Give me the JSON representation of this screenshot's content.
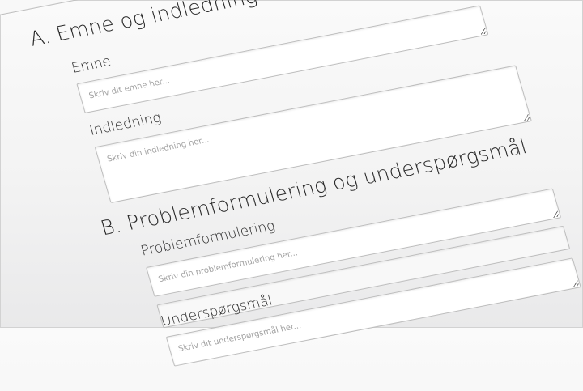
{
  "section_a": {
    "heading": "A. Emne og indledning",
    "subject": {
      "label": "Emne",
      "placeholder": "Skriv dit emne her..."
    },
    "intro": {
      "label": "Indledning",
      "placeholder": "Skriv din indledning her..."
    }
  },
  "section_b": {
    "heading": "B. Problemformulering og underspørgsmål",
    "problem": {
      "label": "Problemformulering",
      "placeholder": "Skriv din problemformulering her..."
    },
    "subquestions": {
      "label": "Underspørgsmål",
      "placeholder": "Skriv dit underspørgsmål her..."
    }
  }
}
